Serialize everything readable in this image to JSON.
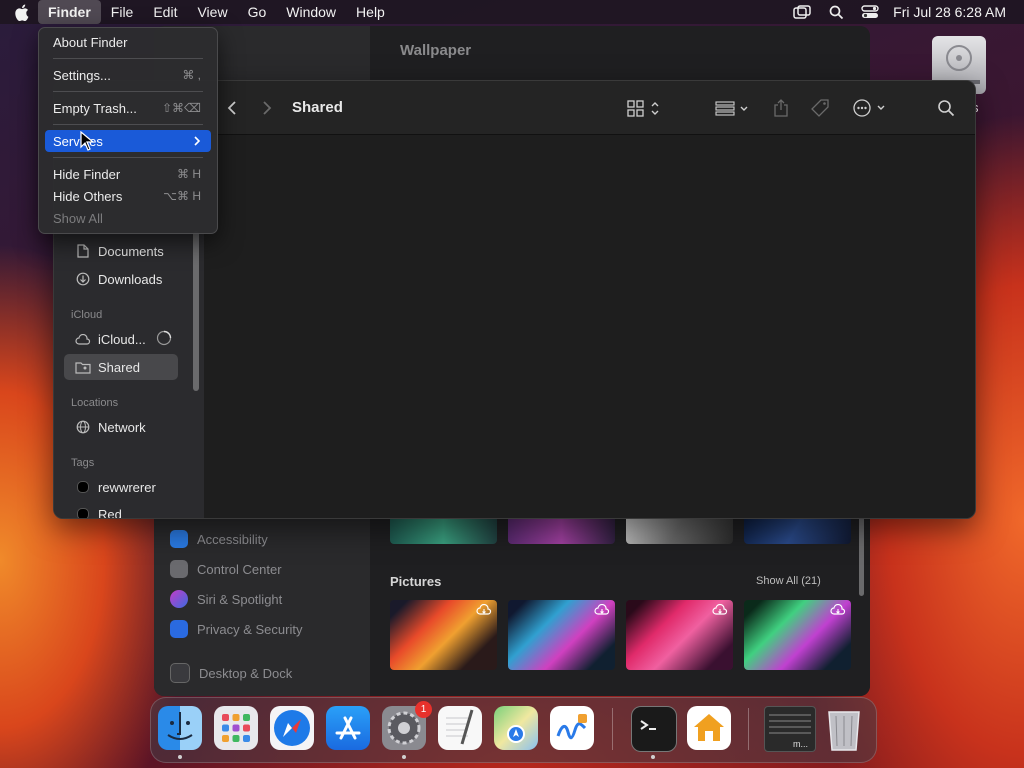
{
  "menubar": {
    "items": [
      "Finder",
      "File",
      "Edit",
      "View",
      "Go",
      "Window",
      "Help"
    ],
    "clock": "Fri Jul 28  6:28 AM"
  },
  "finder_menu": {
    "about": "About Finder",
    "settings": "Settings...",
    "settings_shortcut": "⌘ ,",
    "empty_trash": "Empty Trash...",
    "empty_trash_shortcut": "⇧⌘⌫",
    "services": "Services",
    "hide_finder": "Hide Finder",
    "hide_finder_shortcut": "⌘ H",
    "hide_others": "Hide Others",
    "hide_others_shortcut": "⌥⌘ H",
    "show_all": "Show All"
  },
  "finder": {
    "title": "Shared",
    "sidebar": {
      "favorites": [
        {
          "label": "Documents",
          "icon": "document-icon"
        },
        {
          "label": "Downloads",
          "icon": "download-icon"
        }
      ],
      "icloud_header": "iCloud",
      "icloud_items": [
        {
          "label": "iCloud...",
          "icon": "cloud-icon"
        },
        {
          "label": "Shared",
          "icon": "shared-folder-icon"
        }
      ],
      "locations_header": "Locations",
      "locations": [
        {
          "label": "Network",
          "icon": "network-icon"
        }
      ],
      "tags_header": "Tags",
      "tags": [
        {
          "label": "rewwrerer"
        },
        {
          "label": "Red"
        }
      ]
    }
  },
  "settings_window": {
    "title": "Wallpaper",
    "sidebar": [
      "Accessibility",
      "Control Center",
      "Siri & Spotlight",
      "Privacy & Security",
      "Desktop & Dock"
    ],
    "pictures_label": "Pictures",
    "show_all": "Show All (21)"
  },
  "desktop": {
    "disk_label": "s"
  },
  "dock": {
    "apps": [
      "Finder",
      "Launchpad",
      "Safari",
      "App Store",
      "System Settings",
      "TextEdit",
      "Maps",
      "Freeform",
      "Terminal",
      "Home",
      "Screen Window",
      "Trash"
    ],
    "settings_badge": "1",
    "window_thumb_label": "m..."
  },
  "colors": {
    "menu_highlight": "#1a5ad8",
    "badge": "#e8312c"
  }
}
